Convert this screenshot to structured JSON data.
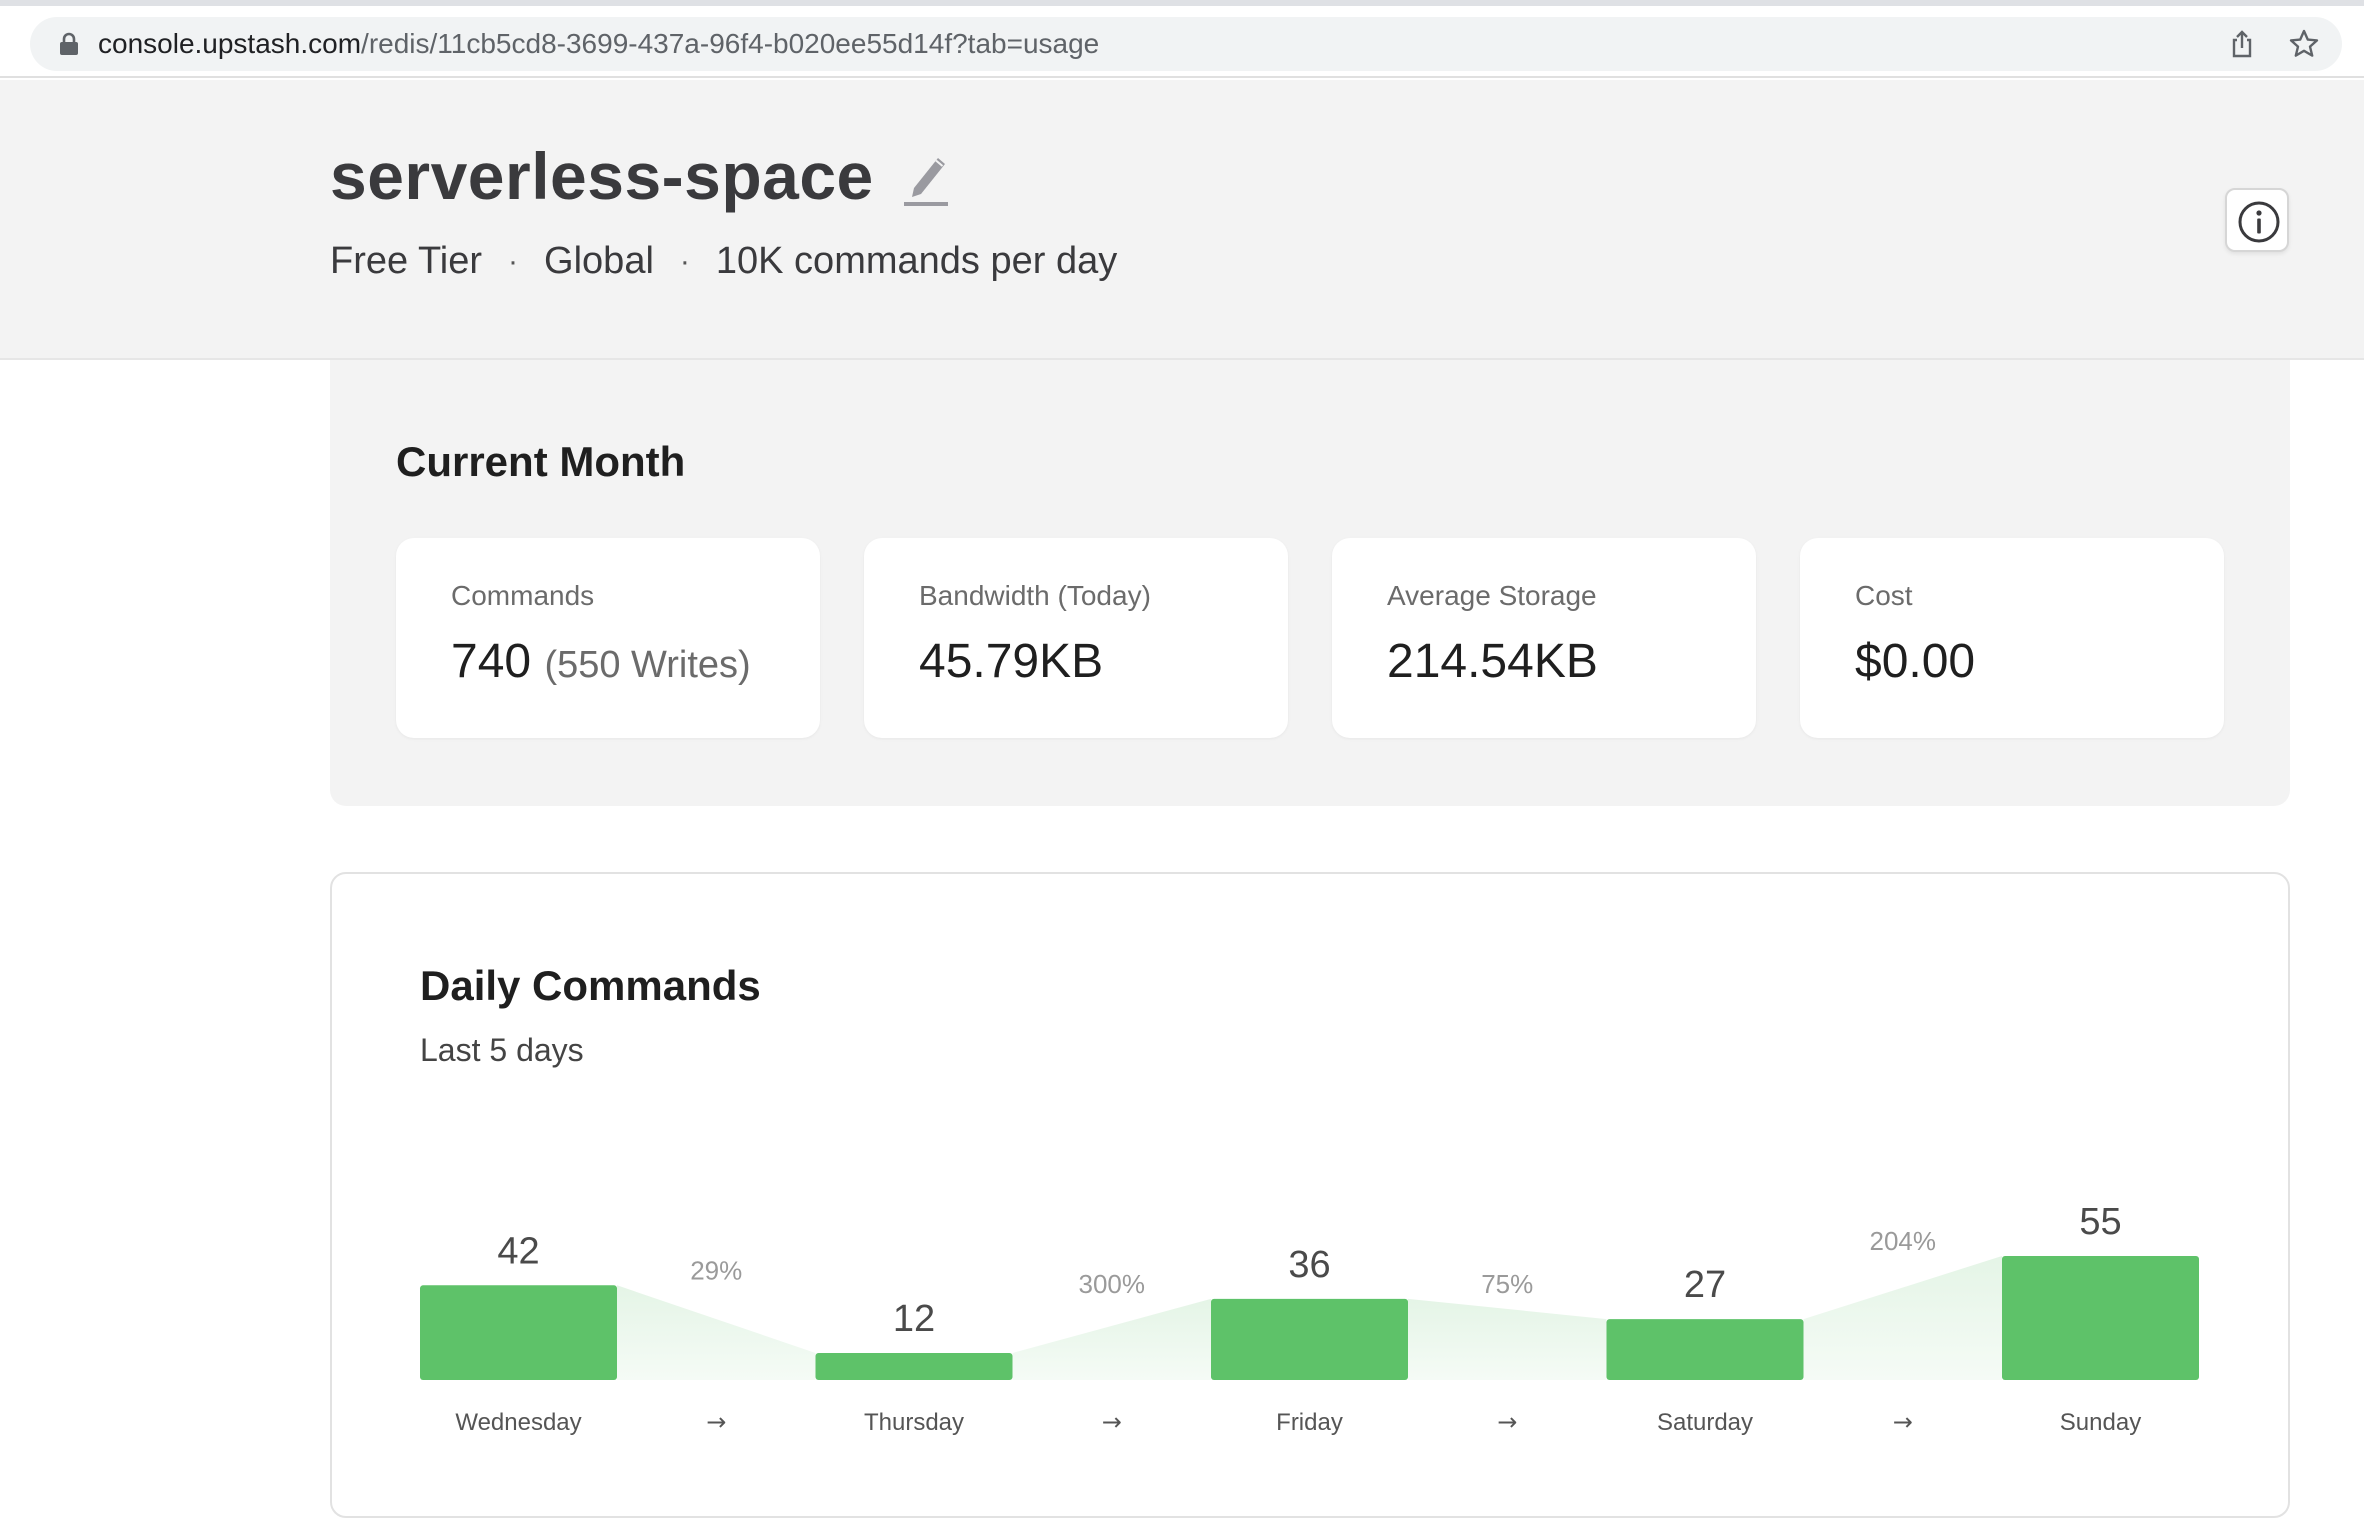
{
  "browser": {
    "url_host": "console.upstash.com",
    "url_path": "/redis/11cb5cd8-3699-437a-96f4-b020ee55d14f?tab=usage",
    "icons": [
      "lock-icon",
      "share-icon",
      "star-icon"
    ]
  },
  "header": {
    "title": "serverless-space",
    "meta": [
      "Free Tier",
      "Global",
      "10K commands per day"
    ],
    "separator": "·",
    "icons": [
      "pencil-icon",
      "info-icon"
    ]
  },
  "current_month": {
    "title": "Current Month",
    "cards": [
      {
        "label": "Commands",
        "value": "740",
        "sub": "(550 Writes)"
      },
      {
        "label": "Bandwidth (Today)",
        "value": "45.79KB"
      },
      {
        "label": "Average Storage",
        "value": "214.54KB"
      },
      {
        "label": "Cost",
        "value": "$0.00"
      }
    ]
  },
  "daily_commands": {
    "title": "Daily Commands",
    "subtitle": "Last 5 days",
    "arrow": "→"
  },
  "colors": {
    "bar": "#5ec269",
    "bar_fill_light": "#e3f4e5",
    "header_bg": "#f3f3f3",
    "text_dark": "#3a3a3d"
  },
  "chart_data": {
    "type": "bar",
    "categories": [
      "Wednesday",
      "Thursday",
      "Friday",
      "Saturday",
      "Sunday"
    ],
    "values": [
      42,
      12,
      36,
      27,
      55
    ],
    "changes": [
      "29%",
      "300%",
      "75%",
      "204%"
    ],
    "title": "Daily Commands",
    "subtitle": "Last 5 days",
    "xlabel": "",
    "ylabel": "",
    "grid": false,
    "legend": "none"
  }
}
